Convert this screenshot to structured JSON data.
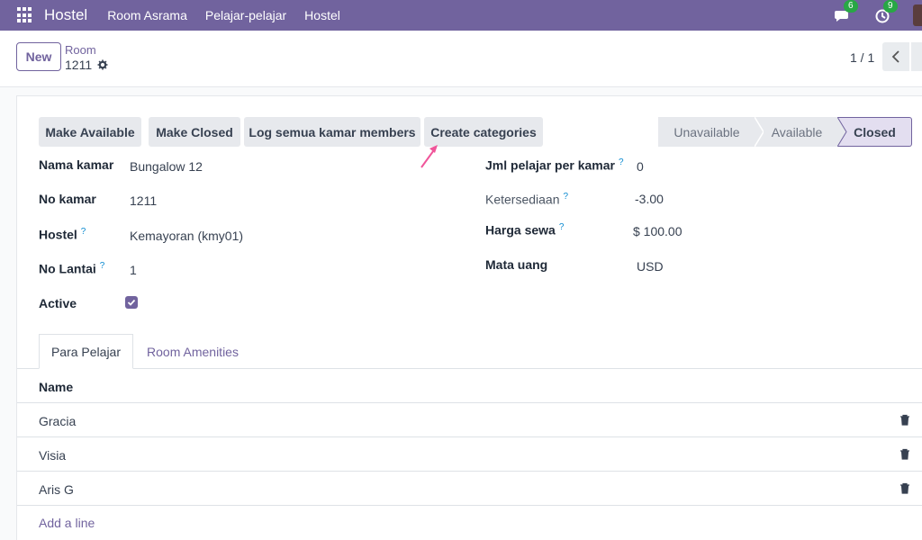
{
  "navbar": {
    "brand": "Hostel",
    "menu": [
      "Room Asrama",
      "Pelajar-pelajar",
      "Hostel"
    ],
    "messages_count": "6",
    "activities_count": "9"
  },
  "control": {
    "new_label": "New",
    "breadcrumb_parent": "Room",
    "breadcrumb_current": "1211",
    "pager": "1 / 1"
  },
  "header": {
    "buttons": [
      "Make Available",
      "Make Closed",
      "Log semua kamar members",
      "Create categories"
    ],
    "stages": [
      "Unavailable",
      "Available",
      "Closed"
    ],
    "active_stage": "Closed"
  },
  "form": {
    "nama_kamar_label": "Nama kamar",
    "nama_kamar": "Bungalow 12",
    "no_kamar_label": "No kamar",
    "no_kamar": "1211",
    "hostel_label": "Hostel",
    "hostel": "Kemayoran (kmy01)",
    "no_lantai_label": "No Lantai",
    "no_lantai": "1",
    "active_label": "Active",
    "active": true,
    "jml_label": "Jml pelajar per kamar",
    "jml": "0",
    "ketersediaan_label": "Ketersediaan",
    "ketersediaan": "-3.00",
    "harga_label": "Harga sewa",
    "harga": "$ 100.00",
    "mata_uang_label": "Mata uang",
    "mata_uang": "USD",
    "help_mark": "?"
  },
  "tabs": [
    "Para Pelajar",
    "Room Amenities"
  ],
  "list": {
    "column": "Name",
    "rows": [
      "Gracia",
      "Visia",
      "Aris G"
    ],
    "add_line": "Add a line"
  },
  "colors": {
    "brand": "#71639e",
    "badge": "#28a745",
    "annotation_arrow": "#f0559a"
  }
}
